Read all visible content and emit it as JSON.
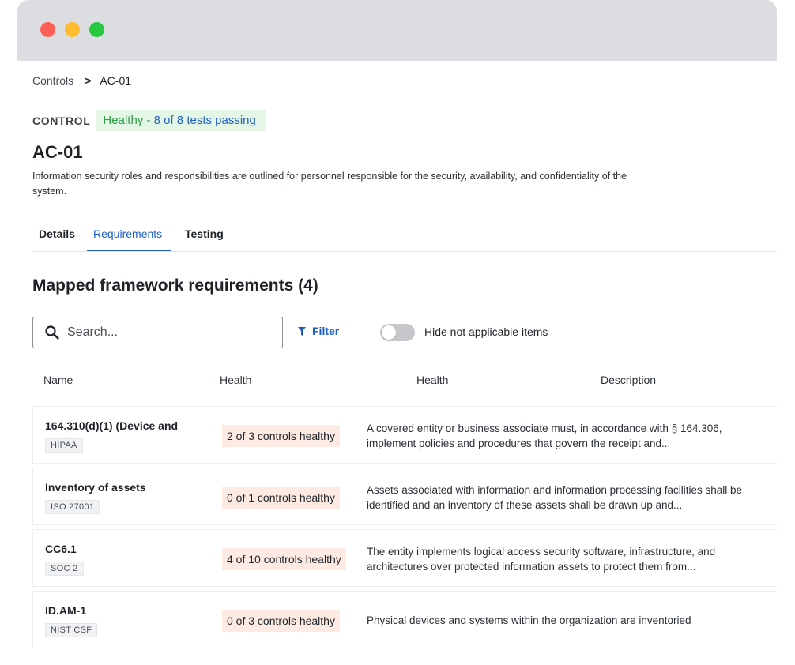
{
  "breadcrumb": {
    "root": "Controls",
    "separator": ">",
    "current": "AC-01"
  },
  "control": {
    "label": "CONTROL",
    "health_text": "Healthy - ",
    "health_count": "8 of 8 tests passing",
    "title": "AC-01",
    "description": "Information security roles and responsibilities are outlined for personnel responsible for the security, availability, and confidentiality of the system."
  },
  "tabs": [
    {
      "label": "Details",
      "active": false
    },
    {
      "label": "Requirements",
      "active": true
    },
    {
      "label": "Testing",
      "active": false
    }
  ],
  "section": {
    "title": "Mapped framework requirements (4)"
  },
  "search": {
    "placeholder": "Search...",
    "value": ""
  },
  "filter": {
    "label": "Filter"
  },
  "toggle": {
    "label": "Hide not applicable items",
    "on": false
  },
  "table": {
    "headers": [
      "Name",
      "Health",
      "Health",
      "Description"
    ],
    "rows": [
      {
        "name": "164.310(d)(1) (Device and",
        "framework": "HIPAA",
        "health": "2 of 3 controls healthy",
        "description": "A covered entity or business associate must, in accordance with § 164.306, implement policies and procedures that govern the receipt and..."
      },
      {
        "name": "Inventory of assets",
        "framework": "ISO 27001",
        "health": "0 of 1 controls healthy",
        "description": "Assets associated with information and information processing facilities shall be identified and an inventory of these assets shall be drawn up and..."
      },
      {
        "name": "CC6.1",
        "framework": "SOC 2",
        "health": "4 of 10 controls healthy",
        "description": "The entity implements logical access security software, infrastructure, and architectures over protected information assets to protect them from..."
      },
      {
        "name": "ID.AM-1",
        "framework": "NIST CSF",
        "health": "0 of 3 controls healthy",
        "description": "Physical devices and systems within the organization are inventoried"
      }
    ]
  },
  "colors": {
    "accent": "#1f5fc4",
    "healthy_green": "#2e9d47",
    "healthy_bg": "#e4f6e6",
    "warning_bg": "#fdebe3"
  },
  "icons": {
    "search": "search-icon",
    "filter": "filter-icon",
    "chevron": "chevron-right-icon"
  }
}
